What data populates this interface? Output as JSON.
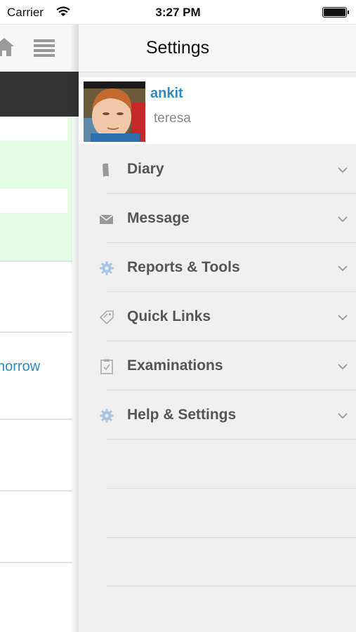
{
  "status_bar": {
    "carrier": "Carrier",
    "time": "3:27 PM"
  },
  "left_panel": {
    "partial_link_text": "norrow"
  },
  "drawer": {
    "title": "Settings",
    "profile": {
      "name": "ankit",
      "subtitle": "teresa"
    },
    "menu_items": [
      {
        "label": "Diary",
        "icon": "book-icon"
      },
      {
        "label": "Message",
        "icon": "envelope-icon"
      },
      {
        "label": "Reports & Tools",
        "icon": "gear-icon"
      },
      {
        "label": "Quick Links",
        "icon": "tag-icon"
      },
      {
        "label": "Examinations",
        "icon": "clipboard-icon"
      },
      {
        "label": "Help & Settings",
        "icon": "gear-icon"
      }
    ]
  },
  "colors": {
    "link_blue": "#2a8bc8",
    "menu_text": "#555555",
    "drawer_bg": "#f0f0f0",
    "dark_bar": "#333333",
    "green_highlight": "#e6fbe6",
    "gear_blue": "#a9c4e4"
  }
}
